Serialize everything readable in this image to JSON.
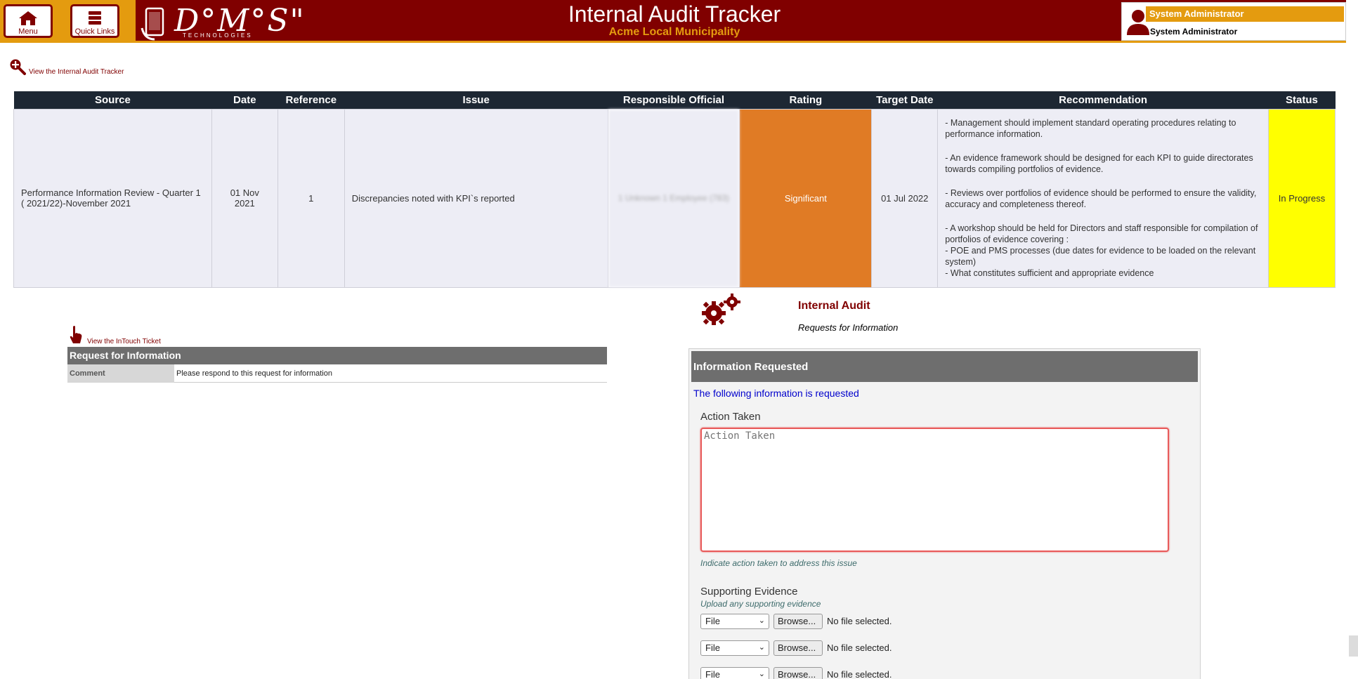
{
  "header": {
    "menu_label": "Menu",
    "quick_links_label": "Quick Links",
    "logo_text": "D°M°S\"",
    "logo_sub": "TECHNOLOGIES",
    "app_title": "Internal Audit Tracker",
    "app_subtitle": "Acme Local Municipality",
    "user_role": "System Administrator",
    "user_name": "System Administrator"
  },
  "tracker_link": "View the Internal Audit Tracker",
  "table": {
    "headers": [
      "Source",
      "Date",
      "Reference",
      "Issue",
      "Responsible Official",
      "Rating",
      "Target Date",
      "Recommendation",
      "Status"
    ],
    "row": {
      "source": "Performance Information Review - Quarter 1 ( 2021/22)-November 2021",
      "date": "01 Nov 2021",
      "reference": "1",
      "issue": "Discrepancies noted with KPI`s reported",
      "responsible_official": "1 Unknown 1 Employee (783)",
      "rating": "Significant",
      "target_date": "01 Jul 2022",
      "recommendation": [
        "- Management should implement standard operating procedures relating to performance information.",
        " - An evidence framework should be designed for each KPI to guide directorates towards compiling portfolios of evidence.",
        " - Reviews over portfolios of evidence should be performed to ensure the validity, accuracy and completeness thereof.",
        " - A workshop should be held for Directors and staff responsible for compilation of portfolios of evidence covering :",
        " - POE and PMS processes (due dates for evidence to be loaded on the relevant system)",
        " - What constitutes sufficient and appropriate evidence"
      ],
      "status": "In Progress"
    }
  },
  "rfi_panel": {
    "intouch_link": "View the InTouch Ticket",
    "heading": "Request for Information",
    "comment_label": "Comment",
    "comment_value": "Please respond to this request for information"
  },
  "form": {
    "section_title": "Internal Audit",
    "section_subtitle": "Requests for Information",
    "heading": "Information Requested",
    "intro": "The following information is requested",
    "action_label": "Action Taken",
    "action_placeholder": "Action Taken",
    "action_hint": "Indicate action taken to address this issue",
    "evidence_label": "Supporting Evidence",
    "evidence_hint": "Upload any supporting evidence",
    "file_type": "File",
    "browse_label": "Browse...",
    "no_file": "No file selected."
  },
  "colors": {
    "brand": "#800000",
    "accent": "#e49b0f",
    "rating_significant": "#e07b25",
    "status_in_progress": "#ffff00",
    "table_header": "#1d2733"
  }
}
